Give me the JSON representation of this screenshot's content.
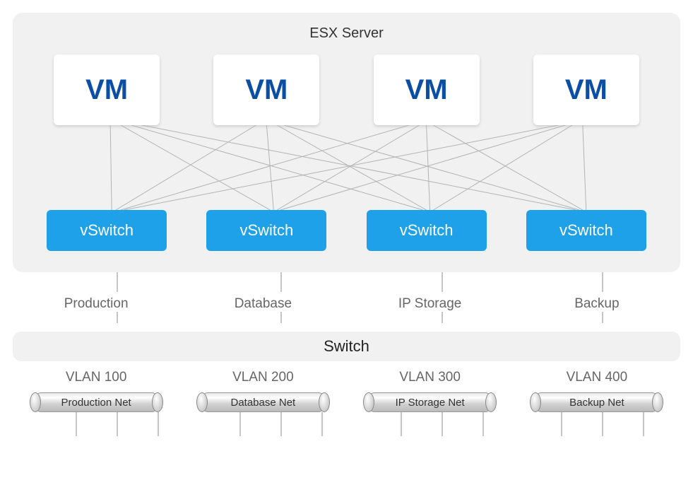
{
  "esx": {
    "title": "ESX Server",
    "vms": [
      "VM",
      "VM",
      "VM",
      "VM"
    ],
    "vswitches": [
      "vSwitch",
      "vSwitch",
      "vSwitch",
      "vSwitch"
    ]
  },
  "network_labels": [
    "Production",
    "Database",
    "IP Storage",
    "Backup"
  ],
  "switch": {
    "label": "Switch"
  },
  "vlans": [
    "VLAN 100",
    "VLAN 200",
    "VLAN 300",
    "VLAN 400"
  ],
  "pipes": [
    "Production Net",
    "Database Net",
    "IP Storage Net",
    "Backup Net"
  ],
  "colors": {
    "vm_text": "#0b4fa5",
    "vswitch_bg": "#1ea1e8"
  }
}
